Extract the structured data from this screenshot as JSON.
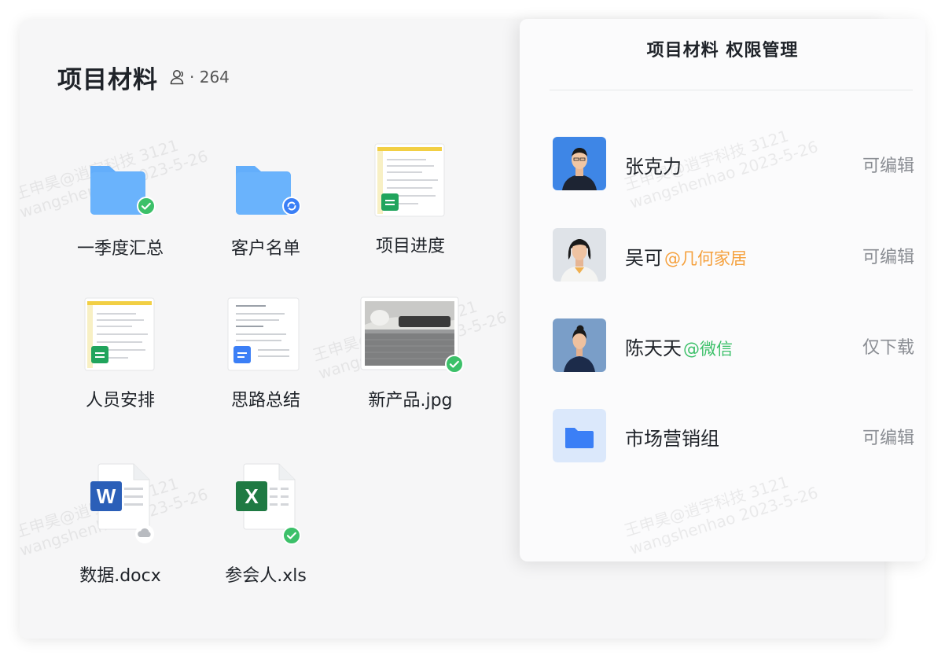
{
  "folder": {
    "title": "项目材料",
    "member_count": "· 264"
  },
  "files": [
    {
      "label": "一季度汇总",
      "kind": "folder",
      "status": "synced"
    },
    {
      "label": "客户名单",
      "kind": "folder",
      "status": "syncing"
    },
    {
      "label": "项目进度",
      "kind": "sheet-doc",
      "status": "none"
    },
    {
      "label": "人员安排",
      "kind": "sheet-doc",
      "status": "none"
    },
    {
      "label": "思路总结",
      "kind": "text-doc",
      "status": "none"
    },
    {
      "label": "新产品.jpg",
      "kind": "image",
      "status": "synced"
    },
    {
      "label": "数据.docx",
      "kind": "word",
      "status": "cloud"
    },
    {
      "label": "参会人.xls",
      "kind": "excel",
      "status": "synced"
    }
  ],
  "permissions_panel": {
    "title": "项目材料 权限管理",
    "entries": [
      {
        "name": "张克力",
        "org": "",
        "org_color": "",
        "permission": "可编辑",
        "avatar": "person-male"
      },
      {
        "name": "吴可",
        "org": "@几何家居",
        "org_color": "#f5a03c",
        "permission": "可编辑",
        "avatar": "person-female"
      },
      {
        "name": "陈天天",
        "org": "@微信",
        "org_color": "#3cc069",
        "permission": "仅下载",
        "avatar": "person-female-2"
      },
      {
        "name": "市场营销组",
        "org": "",
        "org_color": "",
        "permission": "可编辑",
        "avatar": "folder"
      }
    ]
  },
  "watermark": {
    "line1": "王申昊@逍宇科技 3121",
    "line2": "wangshenhao 2023-5-26"
  },
  "colors": {
    "accent_blue": "#3b7ff6",
    "folder_blue": "#63aefb",
    "success_green": "#3cc069",
    "sheet_green": "#20a45c",
    "excel_green": "#1f7a43",
    "word_blue": "#2b5fb8"
  }
}
